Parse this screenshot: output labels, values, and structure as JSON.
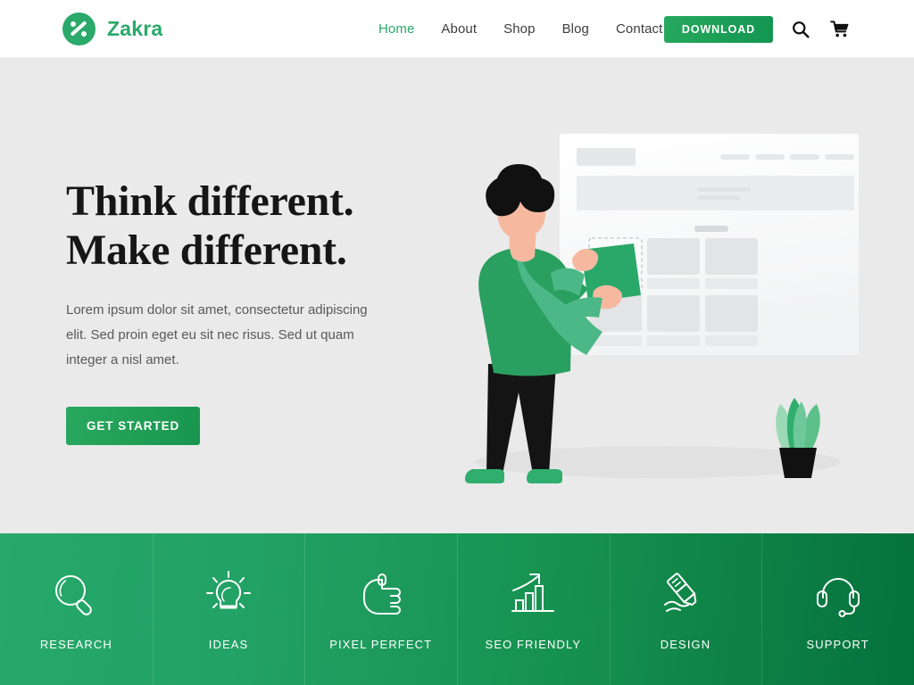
{
  "header": {
    "brand_name": "Zakra",
    "logo_icon": "zakra-circle-logo",
    "nav": [
      {
        "label": "Home",
        "active": true
      },
      {
        "label": "About",
        "active": false
      },
      {
        "label": "Shop",
        "active": false
      },
      {
        "label": "Blog",
        "active": false
      },
      {
        "label": "Contact",
        "active": false
      }
    ],
    "download_label": "DOWNLOAD",
    "search_icon": "search-icon",
    "cart_icon": "shopping-cart-icon",
    "background": "#ffffff"
  },
  "hero": {
    "title_line1": "Think different.",
    "title_line2": "Make different.",
    "paragraph": "Lorem ipsum dolor sit amet, consectetur adipiscing elit. Sed proin eget eu sit nec risus. Sed ut quam integer a nisl amet.",
    "cta_label": "GET STARTED",
    "background": "#eaeaea",
    "illustration": "person-placing-card-on-wireframe-board"
  },
  "features": {
    "items": [
      {
        "label": "RESEARCH",
        "icon": "magnifier-icon"
      },
      {
        "label": "IDEAS",
        "icon": "lightbulb-icon"
      },
      {
        "label": "PIXEL PERFECT",
        "icon": "thumbs-up-icon"
      },
      {
        "label": "SEO FRIENDLY",
        "icon": "bar-chart-arrow-icon"
      },
      {
        "label": "DESIGN",
        "icon": "marker-pen-icon"
      },
      {
        "label": "SUPPORT",
        "icon": "headset-icon"
      }
    ],
    "gradient_from": "#26a96b",
    "gradient_to": "#05713d"
  },
  "colors": {
    "brand_green": "#2aa96a",
    "accent_dark_green": "#05713d",
    "hero_bg": "#eaeaea",
    "text_dark": "#161616",
    "text_muted": "#58595b"
  }
}
